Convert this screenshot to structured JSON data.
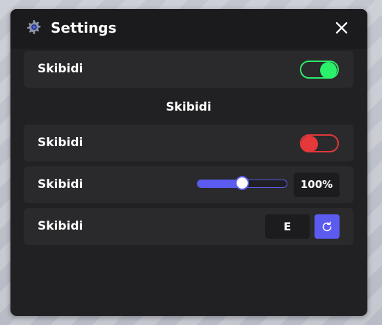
{
  "window": {
    "title": "Settings",
    "title_icon": "gear-icon",
    "close_icon": "close-icon"
  },
  "rows": [
    {
      "label": "Skibidi",
      "control": "toggle",
      "state": "on",
      "color": "#2bf06a"
    },
    {
      "section_header": "Skibidi"
    },
    {
      "label": "Skibidi",
      "control": "toggle",
      "state": "off",
      "color": "#e5383b"
    },
    {
      "label": "Skibidi",
      "control": "slider",
      "value_percent": 50,
      "value_text": "100%",
      "color": "#5b5bf0"
    },
    {
      "label": "Skibidi",
      "control": "keybind",
      "key": "E",
      "reset_icon": "refresh-icon",
      "color": "#5b5bf0"
    }
  ]
}
